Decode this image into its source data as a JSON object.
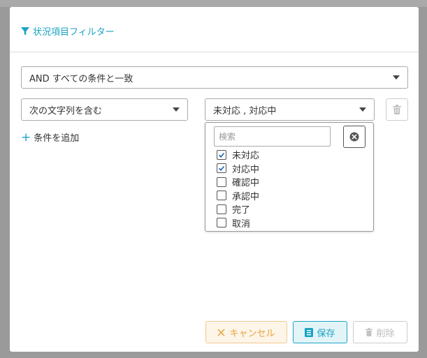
{
  "header": {
    "title": "状況項目フィルター"
  },
  "match_select": {
    "value": "AND すべての条件と一致"
  },
  "condition": {
    "operator_value": "次の文字列を含む",
    "values_selected": "未対応 , 対応中"
  },
  "add_condition_label": "条件を追加",
  "dropdown": {
    "search_placeholder": "検索",
    "options": [
      {
        "label": "未対応",
        "checked": true
      },
      {
        "label": "対応中",
        "checked": true
      },
      {
        "label": "確認中",
        "checked": false
      },
      {
        "label": "承認中",
        "checked": false
      },
      {
        "label": "完了",
        "checked": false
      },
      {
        "label": "取消",
        "checked": false
      }
    ]
  },
  "footer": {
    "cancel_label": "キャンセル",
    "save_label": "保存",
    "delete_label": "削除"
  },
  "colors": {
    "accent": "#1aa3c4",
    "cancel_border": "#f3c98f",
    "cancel_bg": "#fdf5e8",
    "cancel_text": "#e9a23b",
    "save_bg": "#e3f4f9"
  }
}
